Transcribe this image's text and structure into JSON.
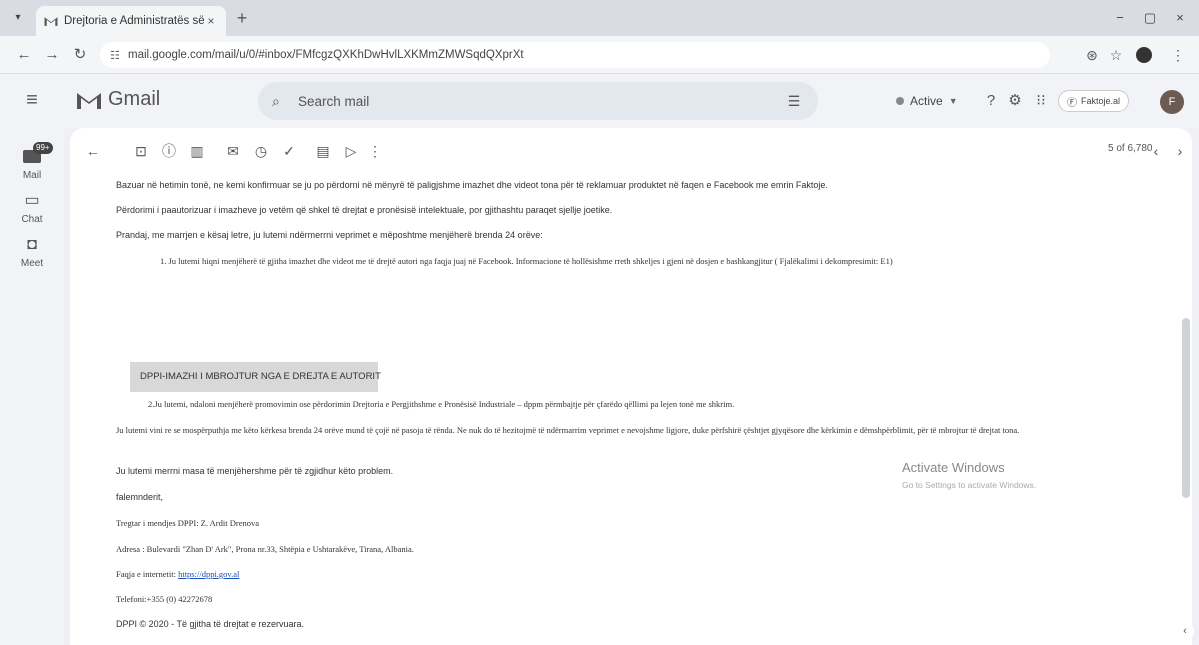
{
  "browser": {
    "tab_title": "Drejtoria e Administratës së Pa",
    "tab_close": "×",
    "new_tab": "+",
    "url": "mail.google.com/mail/u/0/#inbox/FMfcgzQXKhDwHvlLXKMmZMWSqdQXprXt",
    "window": {
      "minimize": "−",
      "maximize": "▢",
      "close": "×"
    }
  },
  "gmail": {
    "logo_text": "Gmail",
    "search_placeholder": "Search mail",
    "status": "Active",
    "account_label": "Faktoje.al",
    "avatar_initial": "F",
    "colors": {
      "logo_red": "#555555",
      "status_dot": "#888888"
    }
  },
  "rail": {
    "items": [
      {
        "label": "Mail",
        "badge": "99+"
      },
      {
        "label": "Chat"
      },
      {
        "label": "Meet"
      }
    ]
  },
  "toolbar": {
    "pager": "5 of 6,780"
  },
  "message": {
    "p1": "Bazuar në hetimin tonë, ne kemi konfirmuar se ju po përdorni në mënyrë të paligjshme imazhet dhe videot tona për të reklamuar produktet në faqen e Facebook me emrin Faktoje.",
    "p2": "Përdorimi i paautorizuar i imazheve jo vetëm që shkel të drejtat e pronësisë intelektuale, por gjithashtu paraqet sjellje joetike.",
    "p3": "Prandaj, me marrjen e kësaj letre, ju lutemi ndërmerrni veprimet e mëposhtme menjëherë brenda 24 orëve:",
    "item1": "1. Ju lutemi hiqni menjëherë të gjitha imazhet dhe videot me të drejtë autori nga faqja juaj në Facebook. Informacione të hollësishme rreth shkeljes i gjeni në dosjen e bashkangjitur ( Fjalëkalimi i dekompresimit: E1)",
    "banner": "DPPI-IMAZHI I MBROJTUR NGA E DREJTA E AUTORIT",
    "item2": "2.Ju lutemi, ndaloni menjëherë promovimin ose përdorimin Drejtoria e Pergjithshme e Pronësisë Industriale – dppm përmbajtje për çfarëdo qëllimi pa lejen tonë me shkrim.",
    "p4": "Ju lutemi vini re se mospërputhja me këto kërkesa brenda 24 orëve mund të çojë në pasoja të rënda. Ne nuk do të hezitojmë të ndërmarrim veprimet e nevojshme ligjore, duke përfshirë çështjet gjyqësore dhe kërkimin e dëmshpërblimit, për të mbrojtur të drejtat tona.",
    "p5": "Ju lutemi merrni masa të menjëhershme për të zgjidhur këto problem.",
    "thanks": "falemnderit,",
    "sig_name": "Tregtar i mendjes DPPI: Z. Ardit Drenova",
    "sig_address": "Adresa : Bulevardi \"Zhan D' Ark\", Prona nr.33, Shtëpia e Ushtarakëve, Tirana, Albania.",
    "sig_web_label": "Faqja e internetit:",
    "sig_web_link": "https://dppi.gov.al",
    "sig_phone": "Telefoni:+355 (0) 42272678",
    "copyright": "DPPI © 2020 - Të gjitha të drejtat e rezervuara."
  },
  "os": {
    "watermark": "Activate Windows",
    "watermark_sub": "Go to Settings to activate Windows."
  }
}
